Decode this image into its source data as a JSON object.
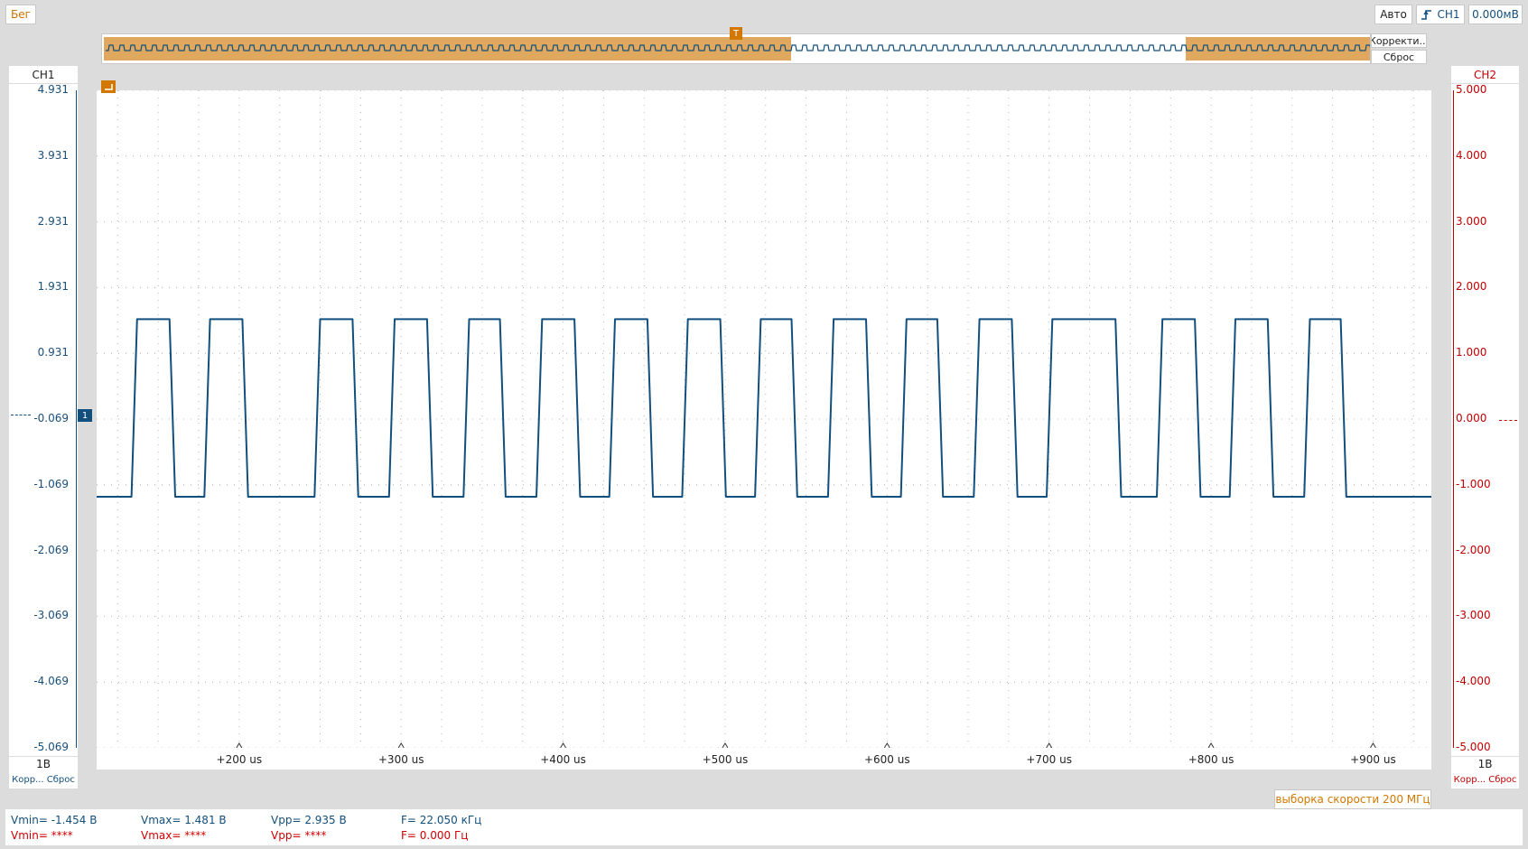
{
  "status": {
    "run_label": "Бег",
    "auto_label": "Авто",
    "trigger_channel": "CH1",
    "trigger_level": "0.000мВ"
  },
  "overview": {
    "correct_label": "Корректи...",
    "reset_label": "Сброс",
    "trigger_marker": "T"
  },
  "ch1": {
    "title": "CH1",
    "scale": "1В",
    "footer": "Корр... Сброс",
    "color": "#124f7d",
    "ticks": [
      "4.931",
      "3.931",
      "2.931",
      "1.931",
      "0.931",
      "-0.069",
      "-1.069",
      "-2.069",
      "-3.069",
      "-4.069",
      "-5.069"
    ],
    "marker_label": "1"
  },
  "ch2": {
    "title": "CH2",
    "scale": "1В",
    "footer": "Корр... Сброс",
    "color": "#d10000",
    "ticks": [
      "5.000",
      "4.000",
      "3.000",
      "2.000",
      "1.000",
      "0.000",
      "-1.000",
      "-2.000",
      "-3.000",
      "-4.000",
      "-5.000"
    ]
  },
  "xaxis": {
    "labels": [
      "+200 us",
      "+300 us",
      "+400 us",
      "+500 us",
      "+600 us",
      "+700 us",
      "+800 us",
      "+900 us"
    ]
  },
  "sample_rate": "выборка скорости 200 МГц",
  "measurements": {
    "ch1": {
      "vmin": "Vmin= -1.454 В",
      "vmax": "Vmax= 1.481 В",
      "vpp": "Vpp= 2.935 В",
      "freq": "F= 22.050 кГц"
    },
    "ch2": {
      "vmin": "Vmin= ****",
      "vmax": "Vmax= ****",
      "vpp": "Vpp= ****",
      "freq": "F= 0.000 Гц"
    }
  },
  "chart_data": {
    "type": "line",
    "xlabel": "",
    "ylabel": "",
    "xlim": [
      112,
      936
    ],
    "x_unit": "us",
    "ylim": [
      -5.069,
      4.931
    ],
    "y_unit": "В",
    "grid": true,
    "series": [
      {
        "name": "CH1",
        "color": "#124f7d",
        "low": -1.25,
        "high": 1.45,
        "pulses": [
          [
            137,
            157
          ],
          [
            182,
            202
          ],
          [
            250,
            270
          ],
          [
            296,
            316
          ],
          [
            342,
            361
          ],
          [
            387,
            407
          ],
          [
            432,
            452
          ],
          [
            477,
            497
          ],
          [
            522,
            541
          ],
          [
            567,
            587
          ],
          [
            612,
            631
          ],
          [
            657,
            677
          ],
          [
            702,
            741
          ],
          [
            770,
            790
          ],
          [
            815,
            835
          ],
          [
            861,
            880
          ]
        ],
        "edges_us": 3.5
      }
    ]
  }
}
